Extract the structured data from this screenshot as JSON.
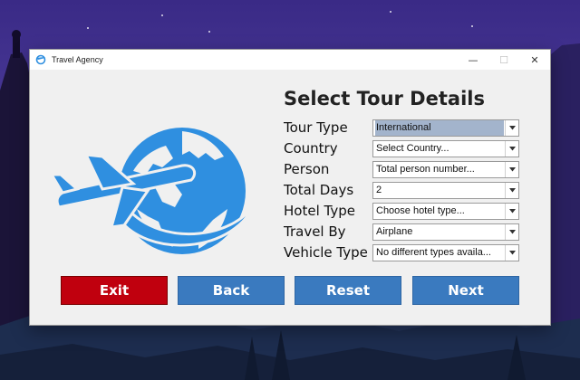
{
  "window": {
    "title": "Travel Agency",
    "controls": {
      "minimize": "—",
      "maximize": "☐",
      "close": "✕"
    }
  },
  "form": {
    "heading": "Select Tour Details",
    "fields": [
      {
        "label": "Tour Type",
        "value": "International"
      },
      {
        "label": "Country",
        "value": "Select Country..."
      },
      {
        "label": "Person",
        "value": "Total person number..."
      },
      {
        "label": "Total Days",
        "value": "2"
      },
      {
        "label": "Hotel Type",
        "value": "Choose hotel type..."
      },
      {
        "label": "Travel By",
        "value": "Airplane"
      },
      {
        "label": "Vehicle Type",
        "value": "No different types availa..."
      }
    ]
  },
  "buttons": {
    "exit": "Exit",
    "back": "Back",
    "reset": "Reset",
    "next": "Next"
  },
  "colors": {
    "exit": "#c0000e",
    "nav": "#3a7abf",
    "globe": "#2f8fe0",
    "selected_field": "#a3b4cc"
  },
  "icons": {
    "app": "globe-airplane-icon",
    "logo": "globe-airplane-logo",
    "dropdown": "chevron-down-icon"
  }
}
